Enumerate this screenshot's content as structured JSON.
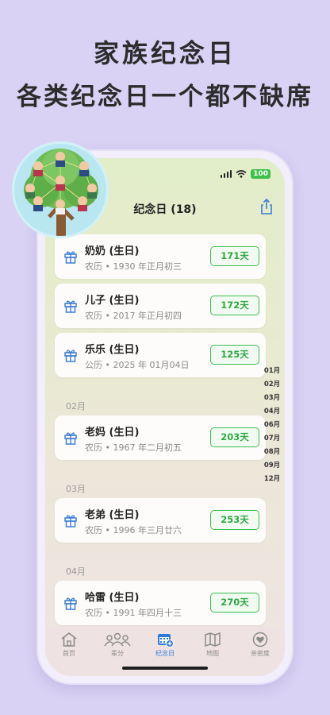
{
  "promo": {
    "line1": "家族纪念日",
    "line2": "各类纪念日一个都不缺席"
  },
  "status_bar": {
    "battery": "100"
  },
  "header": {
    "title": "纪念日 (18)"
  },
  "sections": [
    "02月",
    "03月",
    "04月"
  ],
  "cards": [
    {
      "name": "奶奶 (生日)",
      "sub": "农历 • 1930 年正月初三",
      "days": "171天"
    },
    {
      "name": "儿子 (生日)",
      "sub": "农历 • 2017 年正月初四",
      "days": "172天"
    },
    {
      "name": "乐乐 (生日)",
      "sub": "公历 • 2025 年 01月04日",
      "days": "125天"
    },
    {
      "name": "老妈 (生日)",
      "sub": "农历 • 1967 年二月初五",
      "days": "203天"
    },
    {
      "name": "老弟 (生日)",
      "sub": "农历 • 1996 年三月廿六",
      "days": "253天"
    },
    {
      "name": "哈雷 (生日)",
      "sub": "农历 • 1991 年四月十三",
      "days": "270天"
    }
  ],
  "month_index": [
    "01月",
    "02月",
    "03月",
    "04月",
    "06月",
    "07月",
    "08月",
    "09月",
    "12月"
  ],
  "tabs": [
    {
      "label": "首页",
      "icon": "home-icon"
    },
    {
      "label": "辈分",
      "icon": "people-icon"
    },
    {
      "label": "纪念日",
      "icon": "calendar-add-icon"
    },
    {
      "label": "地图",
      "icon": "map-icon"
    },
    {
      "label": "亲密度",
      "icon": "heart-icon"
    }
  ],
  "colors": {
    "accent_green": "#3cbc50",
    "tab_active": "#2f7ad9",
    "background": "#d9d2f4"
  }
}
